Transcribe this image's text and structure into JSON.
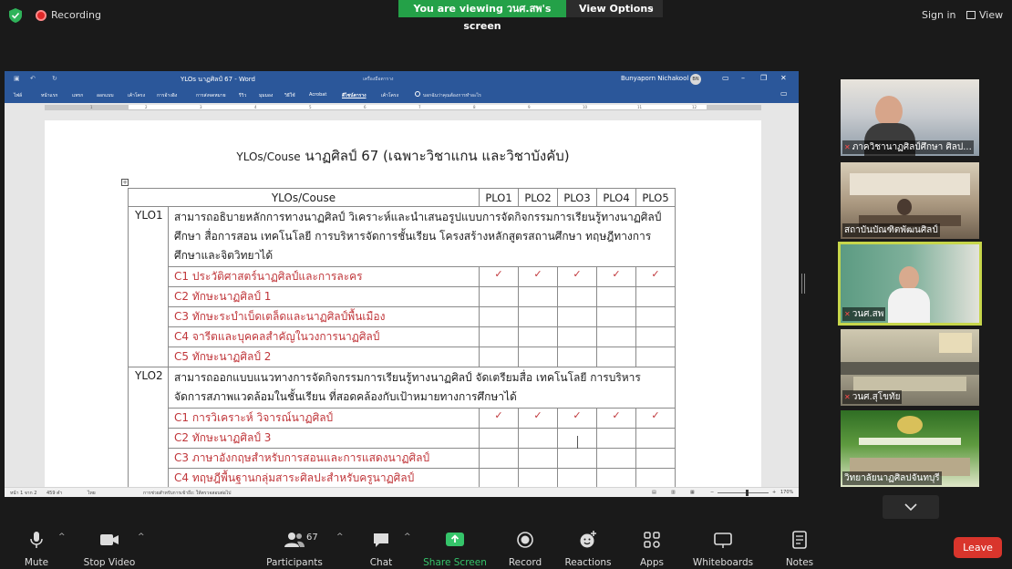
{
  "topbar": {
    "recording_label": "Recording",
    "viewing_banner": "You are viewing วนศ.สพ's screen",
    "view_options_label": "View Options",
    "signin_label": "Sign in",
    "view_label": "View"
  },
  "word": {
    "title": "YLOs นาฏศิลป์ 67  -  Word",
    "ribbon_context_label": "เครื่องมือตาราง",
    "user_name": "Bunyaporn Nichakool",
    "user_initials": "BN",
    "tabs": [
      "ไฟล์",
      "หน้าแรก",
      "แทรก",
      "ออกแบบ",
      "เค้าโครง",
      "การอ้างอิง",
      "การส่งจดหมาย",
      "รีวิว",
      "มุมมอง",
      "วิธีใช้",
      "Acrobat",
      "ดีไซน์ตาราง",
      "เค้าโครง"
    ],
    "active_tab_index": 11,
    "tell_me": "บอกฉันว่าคุณต้องการทำอะไร",
    "status": {
      "page": "หน้า 1 จาก 2",
      "words": "459 คำ",
      "language": "ไทย",
      "accessibility": "การช่วยสำหรับการเข้าถึง: ให้ตรวจสอบต่อไป",
      "zoom": "170%"
    }
  },
  "document": {
    "title_latin": "YLOs/Couse",
    "title_thai": "นาฏศิลป์ 67 (เฉพาะวิชาแกน และวิชาบังคับ)",
    "table": {
      "header_label": "YLOs/Couse",
      "plo_headers": [
        "PLO1",
        "PLO2",
        "PLO3",
        "PLO4",
        "PLO5"
      ],
      "check_mark": "✓",
      "groups": [
        {
          "code": "YLO1",
          "description": "สามารถอธิบายหลักการทางนาฏศิลป์ วิเคราะห์และนำเสนอรูปแบบการจัดกิจกรรมการเรียนรู้ทางนาฏศิลป์ศึกษา สื่อการสอน เทคโนโลยี การบริหารจัดการชั้นเรียน โครงสร้างหลักสูตรสถานศึกษา ทฤษฎีทางการศึกษาและจิตวิทยาได้",
          "courses": [
            {
              "name": "C1 ประวัติศาสตร์นาฏศิลป์และการละคร",
              "checks": [
                true,
                true,
                true,
                true,
                true
              ]
            },
            {
              "name": "C2 ทักษะนาฏศิลป์ 1",
              "checks": [
                false,
                false,
                false,
                false,
                false
              ]
            },
            {
              "name": "C3 ทักษะระบำเบ็ดเตล็ดและนาฏศิลป์พื้นเมือง",
              "checks": [
                false,
                false,
                false,
                false,
                false
              ]
            },
            {
              "name": "C4 จารีตและบุคคลสำคัญในวงการนาฏศิลป์",
              "checks": [
                false,
                false,
                false,
                false,
                false
              ]
            },
            {
              "name": "C5 ทักษะนาฏศิลป์ 2",
              "checks": [
                false,
                false,
                false,
                false,
                false
              ]
            }
          ]
        },
        {
          "code": "YLO2",
          "description": "สามารถออกแบบแนวทางการจัดกิจกรรมการเรียนรู้ทางนาฏศิลป์ จัดเตรียมสื่อ เทคโนโลยี การบริหารจัดการสภาพแวดล้อมในชั้นเรียน ที่สอดคล้องกับเป้าหมายทางการศึกษาได้",
          "courses": [
            {
              "name": "C1  การวิเคราะห์ วิจารณ์นาฏศิลป์",
              "checks": [
                true,
                true,
                true,
                true,
                true
              ]
            },
            {
              "name": "C2 ทักษะนาฏศิลป์ 3",
              "checks": [
                false,
                false,
                false,
                false,
                false
              ]
            },
            {
              "name": "C3 ภาษาอังกฤษสำหรับการสอนและการแสดงนาฏศิลป์",
              "checks": [
                false,
                false,
                false,
                false,
                false
              ]
            },
            {
              "name": "C4 ทฤษฎีพื้นฐานกลุ่มสาระศิลปะสำหรับครูนาฏศิลป์",
              "checks": [
                false,
                false,
                false,
                false,
                false
              ]
            },
            {
              "name": "C5 ทักษะนาฏศิลป์ 4",
              "checks": [
                false,
                false,
                false,
                false,
                false
              ]
            }
          ]
        }
      ]
    }
  },
  "participants": [
    {
      "name": "ภาควิชานาฏศิลป์ศึกษา ศิลป...",
      "muted": true,
      "bg": [
        "#d9d2c4",
        "#b8c7d3"
      ]
    },
    {
      "name": "สถาบันบัณฑิตพัฒนศิลป์",
      "muted": false,
      "bg": [
        "#bcae9a",
        "#8e7e6b"
      ]
    },
    {
      "name": "วนศ.สพ",
      "muted": true,
      "bg": [
        "#6fa38e",
        "#d8d8d0"
      ]
    },
    {
      "name": "วนศ.สุโขทัย",
      "muted": true,
      "bg": [
        "#c9c1a8",
        "#8f8a78"
      ]
    },
    {
      "name": "วิทยาลัยนาฏศิลปจันทบุรี",
      "muted": false,
      "bg": [
        "#3f7d2f",
        "#c9d7a8"
      ]
    }
  ],
  "toolbar": {
    "mute": "Mute",
    "stop_video": "Stop Video",
    "participants": "Participants",
    "participants_count": "67",
    "chat": "Chat",
    "share_screen": "Share Screen",
    "record": "Record",
    "reactions": "Reactions",
    "apps": "Apps",
    "whiteboards": "Whiteboards",
    "notes": "Notes",
    "leave": "Leave"
  },
  "colors": {
    "banner_green": "#24a148",
    "word_blue": "#2b579a",
    "leave_red": "#d9352c",
    "check_red": "#c0363a",
    "active_tile_border": "#c7d64b"
  }
}
